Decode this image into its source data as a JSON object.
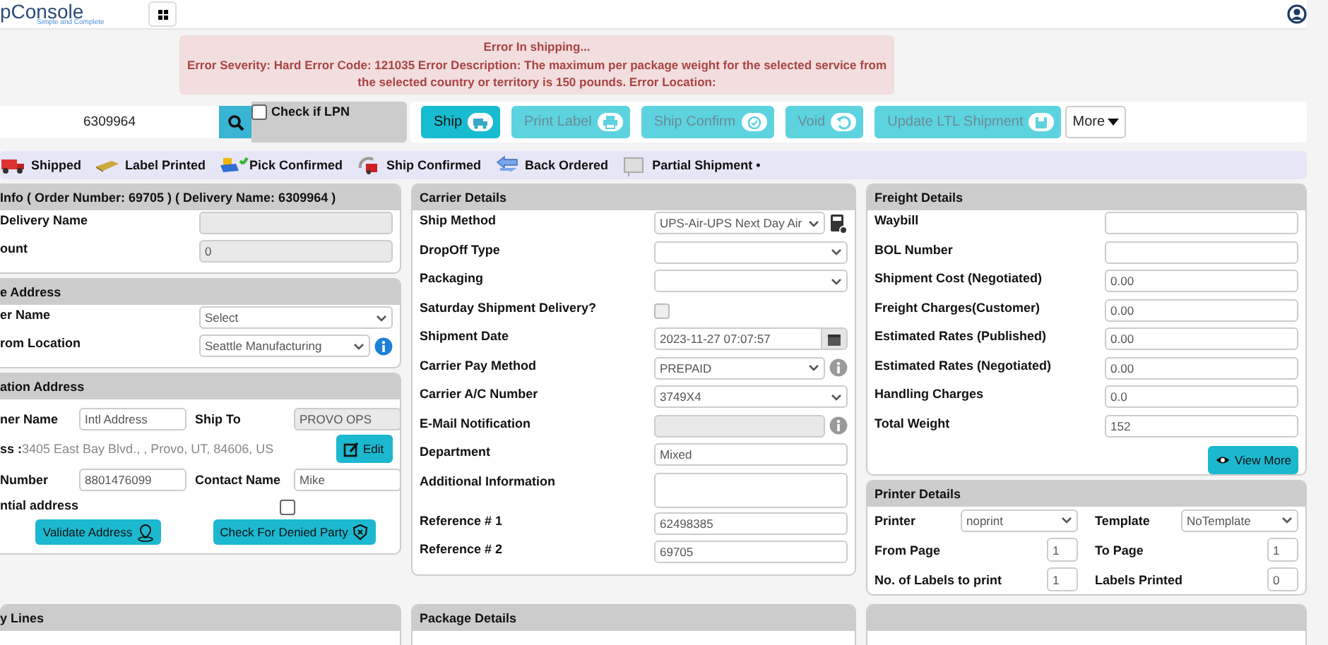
{
  "header": {
    "logo": "pConsole",
    "tagline": "Simple and Complete"
  },
  "error": {
    "title": "Error In shipping...",
    "message": "Error Severity: Hard Error Code: 121035 Error Description: The maximum per package weight for the selected service from the selected country or territory is 150 pounds. Error Location:"
  },
  "search": {
    "value": "6309964",
    "lpn": {
      "label": "Check if LPN",
      "checked": false
    }
  },
  "actions": [
    {
      "label": "Ship",
      "disabled": false,
      "kind": "button"
    },
    {
      "label": "Print Label",
      "disabled": true,
      "kind": "button"
    },
    {
      "label": "Ship Confirm",
      "disabled": true,
      "kind": "button"
    },
    {
      "label": "Void",
      "disabled": true,
      "kind": "button"
    },
    {
      "label": "Update LTL Shipment",
      "disabled": true,
      "kind": "button"
    },
    {
      "label": "More",
      "kind": "dropdown"
    }
  ],
  "legend": [
    {
      "label": "Shipped"
    },
    {
      "label": "Label Printed"
    },
    {
      "label": "Pick Confirmed"
    },
    {
      "label": "Ship Confirmed"
    },
    {
      "label": "Back Ordered"
    },
    {
      "label": "Partial Shipment •"
    }
  ],
  "order_info": {
    "title": "Info ( Order Number: 69705 ) ( Delivery Name: 6309964 )",
    "rows": [
      {
        "label": "Delivery Name",
        "kind": "input",
        "value": "",
        "readonly": true
      },
      {
        "label": "ount",
        "kind": "input",
        "value": "0",
        "readonly": true
      }
    ]
  },
  "source_address": {
    "title": "e Address",
    "rows": [
      {
        "label": "er Name",
        "kind": "select",
        "value": "Select",
        "readonly": false
      },
      {
        "label": "rom Location",
        "kind": "select",
        "value": "Seattle Manufacturing",
        "readonly": false,
        "info": true
      }
    ]
  },
  "destination": {
    "title": "ation Address",
    "customer_label": "ner Name",
    "customer_value": "Intl Address",
    "ship_to_label": "Ship To",
    "ship_to_value": "PROVO OPS",
    "ship_to_readonly": true,
    "address_label": "ss :",
    "address": "3405 East Bay Blvd., , Provo, UT, 84606, US",
    "edit": "Edit",
    "phone_label": "Number",
    "phone": "8801476099",
    "contact_label": "Contact Name",
    "contact": "Mike",
    "residential_label": "ntial address",
    "residential": false,
    "validate": "Validate Address",
    "denied": "Check For Denied Party"
  },
  "lines_panel": {
    "title": "y Lines"
  },
  "carrier": {
    "title": "Carrier Details",
    "rows": [
      {
        "label": "Ship Method",
        "kind": "select",
        "value": "UPS-Air-UPS Next Day Air",
        "readonly": false,
        "calculator": true
      },
      {
        "label": "DropOff Type",
        "kind": "select",
        "value": "",
        "readonly": false
      },
      {
        "label": "Packaging",
        "kind": "select",
        "value": "",
        "readonly": false
      },
      {
        "label": "Saturday Shipment Delivery?",
        "kind": "checkbox",
        "checked": false,
        "disabled": true
      },
      {
        "label": "Shipment Date",
        "kind": "date",
        "value": "2023-11-27 07:07:57",
        "readonly": false
      },
      {
        "label": "Carrier Pay Method",
        "kind": "select",
        "value": "PREPAID",
        "readonly": false,
        "info": true
      },
      {
        "label": "Carrier A/C Number",
        "kind": "select",
        "value": "3749X4",
        "readonly": false
      },
      {
        "label": "E-Mail Notification",
        "kind": "input",
        "value": "",
        "readonly": true,
        "info": true
      },
      {
        "label": "Department",
        "kind": "input",
        "value": "Mixed",
        "readonly": false
      },
      {
        "label": "Additional Information",
        "kind": "textarea",
        "value": "",
        "readonly": false
      },
      {
        "label": "Reference # 1",
        "kind": "input",
        "value": "62498385",
        "readonly": false
      },
      {
        "label": "Reference # 2",
        "kind": "input",
        "value": "69705",
        "readonly": false
      }
    ]
  },
  "package_panel": {
    "title": "Package Details"
  },
  "freight": {
    "title": "Freight Details",
    "rows": [
      {
        "label": "Waybill",
        "kind": "input",
        "value": "",
        "readonly": false
      },
      {
        "label": "BOL Number",
        "kind": "input",
        "value": "",
        "readonly": false
      },
      {
        "label": "Shipment Cost (Negotiated)",
        "kind": "input",
        "value": "0.00",
        "readonly": false
      },
      {
        "label": "Freight Charges(Customer)",
        "kind": "input",
        "value": "0.00",
        "readonly": false
      },
      {
        "label": "Estimated Rates (Published)",
        "kind": "input",
        "value": "0.00",
        "readonly": false
      },
      {
        "label": "Estimated Rates (Negotiated)",
        "kind": "input",
        "value": "0.00",
        "readonly": false
      },
      {
        "label": "Handling Charges",
        "kind": "input",
        "value": "0.0",
        "readonly": false
      },
      {
        "label": "Total Weight",
        "kind": "input",
        "value": "152",
        "readonly": false
      }
    ],
    "view_more": "View More"
  },
  "printer": {
    "title": "Printer Details",
    "fields": [
      {
        "label": "Printer",
        "kind": "select",
        "value": "noprint",
        "readonly": false
      },
      {
        "label": "Template",
        "kind": "select",
        "value": "NoTemplate",
        "readonly": false
      },
      {
        "label": "From Page",
        "kind": "small",
        "value": "1",
        "readonly": false
      },
      {
        "label": "To Page",
        "kind": "small",
        "value": "1",
        "readonly": false
      },
      {
        "label": "No. of Labels to print",
        "kind": "small",
        "value": "1",
        "readonly": false
      },
      {
        "label": "Labels Printed",
        "kind": "small",
        "value": "0",
        "readonly": false
      }
    ]
  }
}
